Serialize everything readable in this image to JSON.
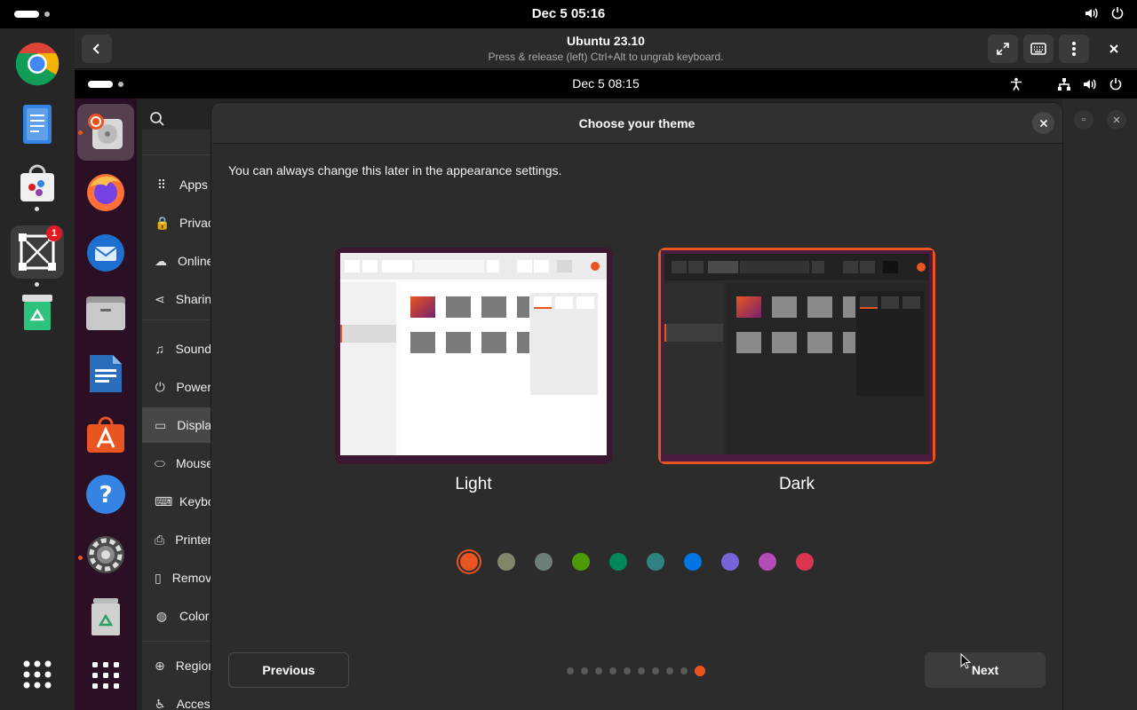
{
  "host": {
    "clock": "Dec 5  05:16",
    "dock": [
      {
        "name": "chrome-icon"
      },
      {
        "name": "text-editor-icon"
      },
      {
        "name": "software-store-icon"
      },
      {
        "name": "virtual-machine-icon",
        "badge": "1"
      },
      {
        "name": "trash-recycle-icon"
      }
    ]
  },
  "vm": {
    "title": "Ubuntu 23.10",
    "subtitle": "Press & release (left) Ctrl+Alt to ungrab keyboard."
  },
  "guest": {
    "clock": "Dec 5  08:15",
    "settings_sidebar": [
      {
        "icon": "⠿",
        "label": "Apps"
      },
      {
        "icon": "🔒",
        "label": "Privacy"
      },
      {
        "icon": "☁",
        "label": "Online Accounts"
      },
      {
        "icon": "⋖",
        "label": "Sharing"
      },
      {
        "icon": "♫",
        "label": "Sound"
      },
      {
        "icon": "⏻",
        "label": "Power"
      },
      {
        "icon": "▭",
        "label": "Displays"
      },
      {
        "icon": "⬭",
        "label": "Mouse & Touchpad"
      },
      {
        "icon": "⌨",
        "label": "Keyboard"
      },
      {
        "icon": "⎙",
        "label": "Printers"
      },
      {
        "icon": "▯",
        "label": "Removable Media"
      },
      {
        "icon": "◍",
        "label": "Color"
      },
      {
        "icon": "⊕",
        "label": "Region & Language"
      },
      {
        "icon": "♿",
        "label": "Accessibility"
      }
    ]
  },
  "dialog": {
    "title": "Choose your theme",
    "description": "You can always change this later in the appearance settings.",
    "themes": [
      {
        "label": "Light",
        "selected": false
      },
      {
        "label": "Dark",
        "selected": true
      }
    ],
    "accent_colors": [
      "#e95420",
      "#838469",
      "#6e7e7a",
      "#4e9a06",
      "#03875b",
      "#308280",
      "#0073e5",
      "#7764d8",
      "#b34cb3",
      "#da3450"
    ],
    "selected_accent": 0,
    "previous_label": "Previous",
    "next_label": "Next",
    "page_count": 10,
    "current_page": 10
  }
}
